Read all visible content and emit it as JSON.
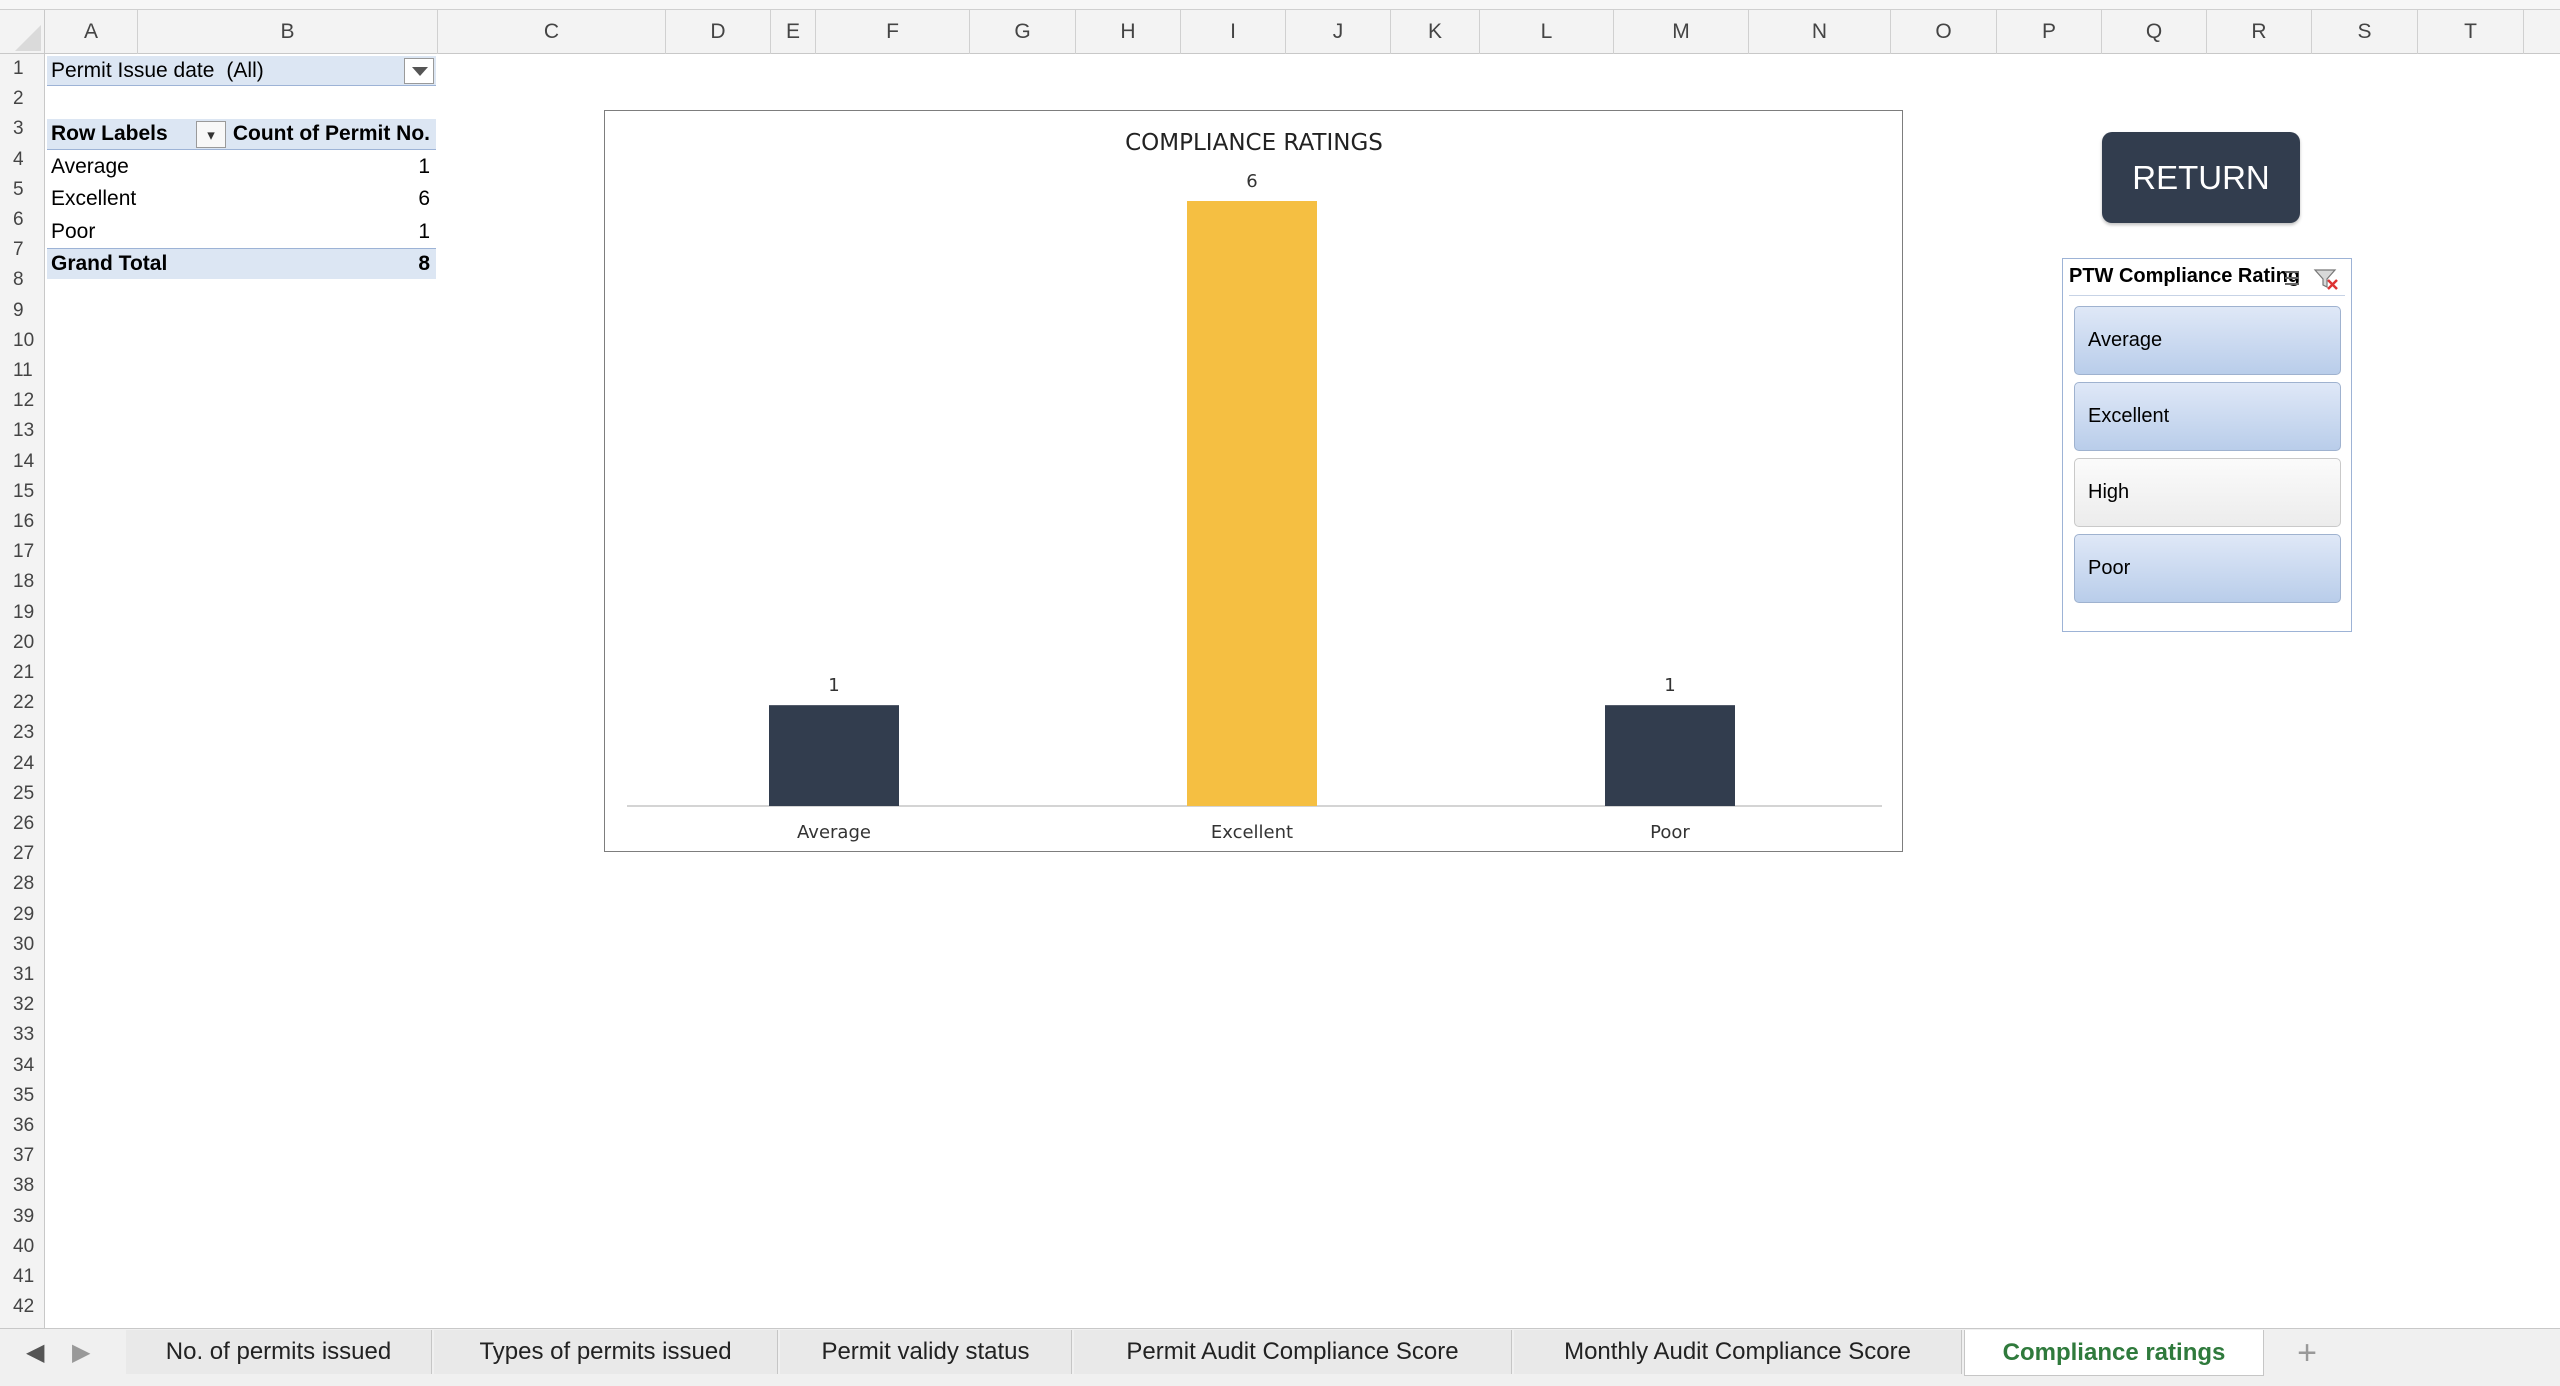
{
  "columns": [
    "A",
    "B",
    "C",
    "D",
    "E",
    "F",
    "G",
    "H",
    "I",
    "J",
    "K",
    "L",
    "M",
    "N",
    "O",
    "P",
    "Q",
    "R",
    "S",
    "T"
  ],
  "rows": [
    "1",
    "2",
    "3",
    "4",
    "5",
    "6",
    "7",
    "8",
    "9",
    "10",
    "11",
    "12",
    "13",
    "14",
    "15",
    "16",
    "17",
    "18",
    "19",
    "20",
    "21",
    "22",
    "23",
    "24",
    "25",
    "26",
    "27",
    "28",
    "29",
    "30",
    "31",
    "32",
    "33",
    "34",
    "35",
    "36",
    "37",
    "38",
    "39",
    "40",
    "41",
    "42"
  ],
  "pivot": {
    "filter_label": "Permit Issue date",
    "filter_value": "(All)",
    "header_row_labels": "Row Labels",
    "header_count": "Count of Permit No.",
    "rows": [
      {
        "label": "Average",
        "count": "1"
      },
      {
        "label": "Excellent",
        "count": "6"
      },
      {
        "label": "Poor",
        "count": "1"
      }
    ],
    "total_label": "Grand Total",
    "total_count": "8"
  },
  "chart_data": {
    "type": "bar",
    "title": "COMPLIANCE RATINGS",
    "categories": [
      "Average",
      "Excellent",
      "Poor"
    ],
    "values": [
      1,
      6,
      1
    ],
    "data_labels": [
      "1",
      "6",
      "1"
    ],
    "colors": [
      "#323d4e",
      "#f5bf42",
      "#323d4e"
    ],
    "ylim": [
      0,
      6
    ],
    "grid": false,
    "legend": "none"
  },
  "return_button": {
    "label": "RETURN",
    "color": "#323d4e"
  },
  "slicer": {
    "title": "PTW Compliance Rating",
    "items": [
      {
        "label": "Average",
        "selected": true
      },
      {
        "label": "Excellent",
        "selected": true
      },
      {
        "label": "High",
        "selected": false
      },
      {
        "label": "Poor",
        "selected": true
      }
    ]
  },
  "tabs": {
    "items": [
      "No. of permits issued",
      "Types of permits issued",
      "Permit validy status",
      "Permit Audit Compliance Score",
      "Monthly Audit Compliance Score",
      "Compliance ratings"
    ],
    "active": "Compliance ratings",
    "add_label": "+"
  },
  "colors": {
    "accent_dark": "#323d4e",
    "accent_yellow": "#f5bf42",
    "active_tab_text": "#2f7a3c",
    "pivot_highlight": "#dce6f3"
  }
}
